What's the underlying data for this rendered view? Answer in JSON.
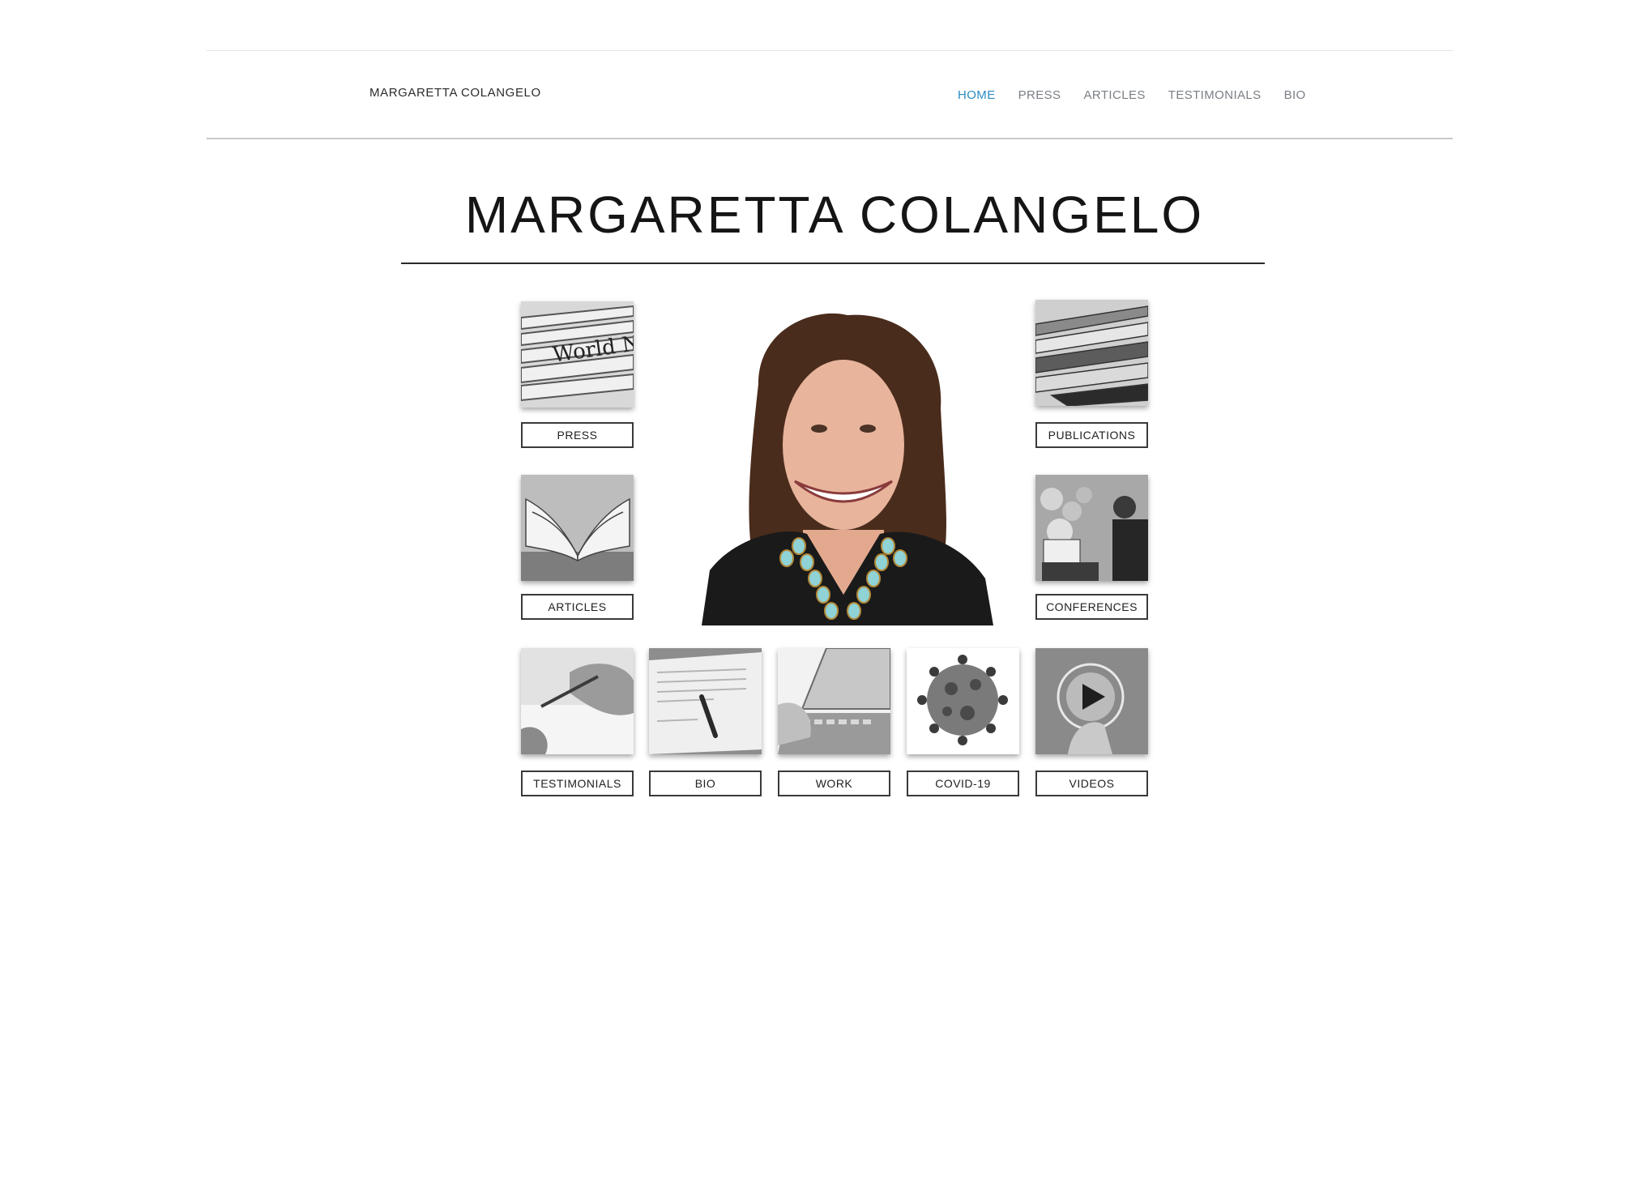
{
  "header": {
    "brand": "MARGARETTA COLANGELO",
    "nav": [
      {
        "label": "HOME",
        "active": true
      },
      {
        "label": "PRESS",
        "active": false
      },
      {
        "label": "ARTICLES",
        "active": false
      },
      {
        "label": "TESTIMONIALS",
        "active": false
      },
      {
        "label": "BIO",
        "active": false
      }
    ],
    "active_color": "#2b8bc1",
    "nav_color": "#7a7f85"
  },
  "main": {
    "title": "MARGARETTA COLANGELO",
    "portrait_icon": "portrait-photo",
    "tiles": [
      {
        "label": "PRESS",
        "icon": "newspapers-image"
      },
      {
        "label": "PUBLICATIONS",
        "icon": "magazines-image"
      },
      {
        "label": "ARTICLES",
        "icon": "open-book-image"
      },
      {
        "label": "CONFERENCES",
        "icon": "speaker-podium-image"
      },
      {
        "label": "TESTIMONIALS",
        "icon": "writing-hand-image"
      },
      {
        "label": "BIO",
        "icon": "document-pen-image"
      },
      {
        "label": "WORK",
        "icon": "laptop-typing-image"
      },
      {
        "label": "COVID-19",
        "icon": "virus-image"
      },
      {
        "label": "VIDEOS",
        "icon": "play-button-image"
      }
    ]
  }
}
